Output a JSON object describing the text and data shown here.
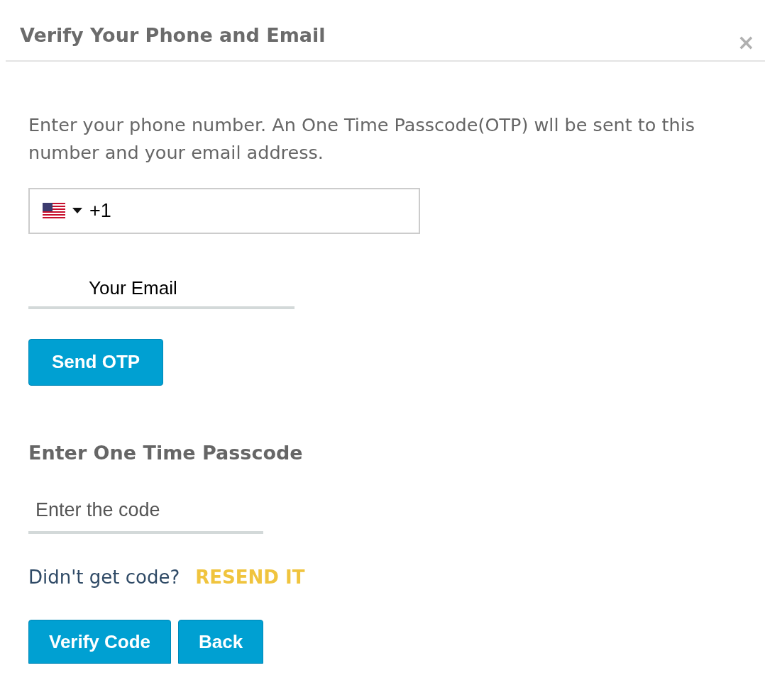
{
  "dialog": {
    "title": "Verify Your Phone and Email",
    "close": "×"
  },
  "intro": "Enter your phone number. An One Time Passcode(OTP) wll be sent to this number and your email address.",
  "phone": {
    "dial_code": "+1"
  },
  "email": {
    "placeholder": "Your Email"
  },
  "send_button": "Send OTP",
  "otp_heading": "Enter One Time Passcode",
  "code": {
    "placeholder": "Enter the code"
  },
  "resend": {
    "prompt": "Didn't get code?",
    "link": "RESEND IT"
  },
  "buttons": [
    "Verify Code",
    "Back"
  ]
}
